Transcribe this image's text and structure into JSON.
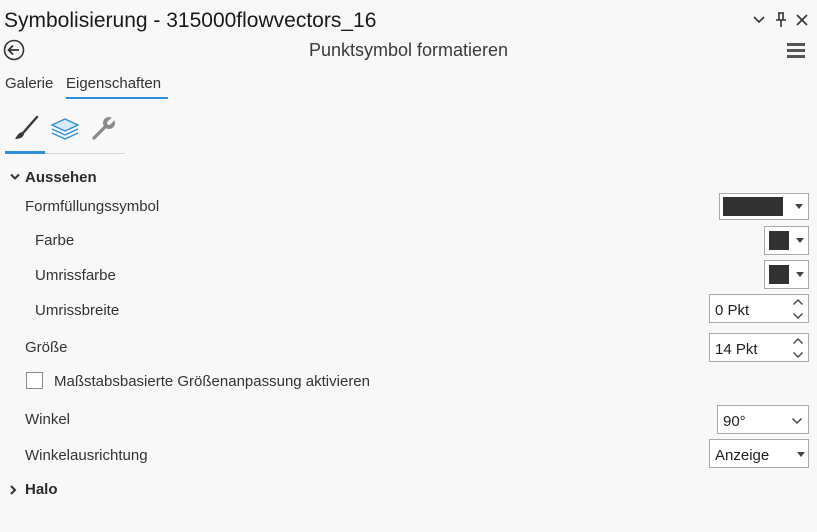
{
  "window": {
    "title": "Symbolisierung - 315000flowvectors_16",
    "subtitle": "Punktsymbol formatieren"
  },
  "tabs": [
    {
      "label": "Galerie",
      "active": false
    },
    {
      "label": "Eigenschaften",
      "active": true
    }
  ],
  "icon_tabs": [
    {
      "icon": "paintbrush-icon",
      "active": true
    },
    {
      "icon": "layers-icon",
      "active": false
    },
    {
      "icon": "wrench-icon",
      "active": false
    }
  ],
  "sections": {
    "appearance": {
      "label": "Aussehen",
      "expanded": true,
      "shape_fill": {
        "label": "Formfüllungssymbol",
        "color": "#323232"
      },
      "color": {
        "label": "Farbe",
        "color": "#323232"
      },
      "outline_color": {
        "label": "Umrissfarbe",
        "color": "#323232"
      },
      "outline_width": {
        "label": "Umrissbreite",
        "value": "0 Pkt"
      },
      "size": {
        "label": "Größe",
        "value": "14 Pkt"
      },
      "scale_based": {
        "label": "Maßstabsbasierte Größenanpassung aktivieren",
        "checked": false
      },
      "angle": {
        "label": "Winkel",
        "value": "90°"
      },
      "angle_alignment": {
        "label": "Winkelausrichtung",
        "value": "Anzeige"
      }
    },
    "halo": {
      "label": "Halo",
      "expanded": false
    }
  },
  "colors": {
    "accent": "#2f8fd8",
    "background": "#f8f8f8"
  }
}
